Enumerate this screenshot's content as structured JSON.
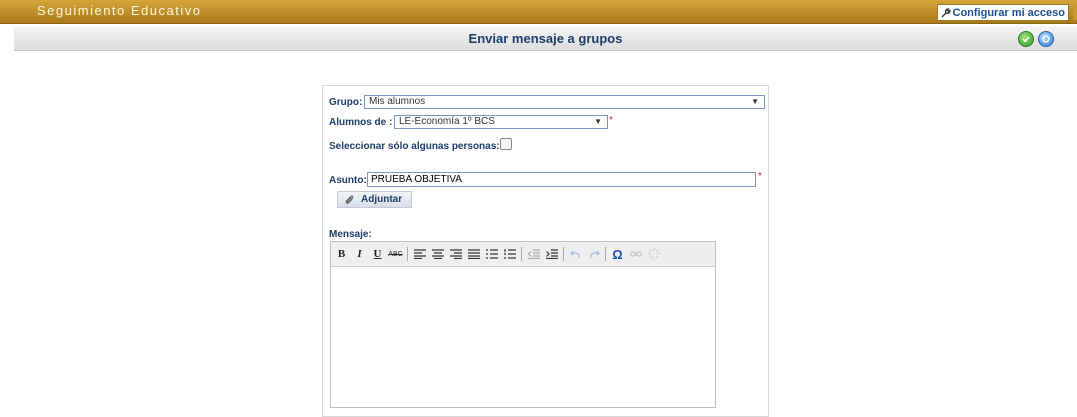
{
  "app": {
    "title": "Seguimiento Educativo",
    "config_label": "Configurar mi acceso"
  },
  "header": {
    "title": "Enviar mensaje a grupos"
  },
  "form": {
    "grupo_label": "Grupo:",
    "grupo_value": "Mis alumnos",
    "alumnos_label": "Alumnos de :",
    "alumnos_value": "LE-Economía 1º BCS",
    "required_mark": "*",
    "select_some_label": "Seleccionar sólo algunas personas:",
    "select_some_checked": false,
    "asunto_label": "Asunto:",
    "asunto_value": "PRUEBA OBJETIVA",
    "attach_label": "Adjuntar",
    "mensaje_label": "Mensaje:",
    "mensaje_value": ""
  },
  "toolbar": {
    "bold": "B",
    "italic": "I",
    "underline": "U",
    "strike": "ABC",
    "omega": "Ω"
  },
  "colors": {
    "brand": "#c2921f",
    "title_text": "#1d3d6b",
    "required": "#e02020"
  }
}
